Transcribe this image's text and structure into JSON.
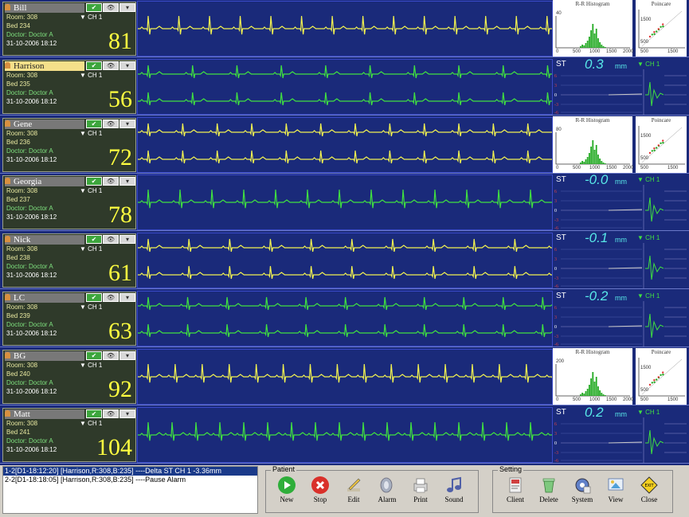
{
  "patients": [
    {
      "name": "Bill",
      "room": "Room: 308",
      "bed": "Bed 234",
      "doctor": "Doctor: Doctor A",
      "datetime": "31-10-2006 18:12",
      "hr": "81",
      "ch": "CH 1",
      "panel": "hist",
      "hist_title": "R-R Histogram",
      "hist_y": "40",
      "hist_x": [
        "0",
        "500",
        "1000",
        "1500",
        "2000"
      ],
      "poin_title": "Poincare",
      "poin_y": [
        "1500",
        "500"
      ],
      "poin_x": [
        "500",
        "1500"
      ],
      "wave_color": "#f2f250",
      "dual": false,
      "name_selected": false
    },
    {
      "name": "Harrison",
      "room": "Room: 308",
      "bed": "Bed 235",
      "doctor": "Doctor: Doctor A",
      "datetime": "31-10-2006 18:12",
      "hr": "56",
      "ch": "CH 1",
      "panel": "st",
      "st_label": "ST",
      "st_value": "0.3",
      "st_unit": "mm",
      "st_ch": "CH 1",
      "wave_color": "#40e040",
      "dual": true,
      "name_selected": true
    },
    {
      "name": "Gene",
      "room": "Room: 308",
      "bed": "Bed 236",
      "doctor": "Doctor: Doctor A",
      "datetime": "31-10-2006 18:12",
      "hr": "72",
      "ch": "CH 1",
      "panel": "hist",
      "hist_title": "R-R Histogram",
      "hist_y": "80",
      "hist_x": [
        "0",
        "500",
        "1000",
        "1500",
        "2000"
      ],
      "poin_title": "Poincare",
      "poin_y": [
        "1500",
        "500"
      ],
      "poin_x": [
        "500",
        "1500"
      ],
      "wave_color": "#f2f250",
      "dual": true,
      "name_selected": false
    },
    {
      "name": "Georgia",
      "room": "Room: 308",
      "bed": "Bed 237",
      "doctor": "Doctor: Doctor A",
      "datetime": "31-10-2006 18:12",
      "hr": "78",
      "ch": "CH 1",
      "panel": "st",
      "st_label": "ST",
      "st_value": "-0.0",
      "st_unit": "mm",
      "st_ch": "CH 1",
      "wave_color": "#40e040",
      "dual": false,
      "name_selected": false
    },
    {
      "name": "Nick",
      "room": "Room: 308",
      "bed": "Bed 238",
      "doctor": "Doctor: Doctor A",
      "datetime": "31-10-2006 18:12",
      "hr": "61",
      "ch": "CH 1",
      "panel": "st",
      "st_label": "ST",
      "st_value": "-0.1",
      "st_unit": "mm",
      "st_ch": "CH 1",
      "wave_color": "#f2f250",
      "dual": true,
      "name_selected": false
    },
    {
      "name": "LC",
      "room": "Room: 308",
      "bed": "Bed 239",
      "doctor": "Doctor: Doctor A",
      "datetime": "31-10-2006 18:12",
      "hr": "63",
      "ch": "CH 1",
      "panel": "st",
      "st_label": "ST",
      "st_value": "-0.2",
      "st_unit": "mm",
      "st_ch": "CH 1",
      "wave_color": "#40e040",
      "dual": true,
      "name_selected": false
    },
    {
      "name": "BG",
      "room": "Room: 308",
      "bed": "Bed 240",
      "doctor": "Doctor: Doctor A",
      "datetime": "31-10-2006 18:12",
      "hr": "92",
      "ch": "CH 1",
      "panel": "hist",
      "hist_title": "R-R Histogram",
      "hist_y": "200",
      "hist_x": [
        "0",
        "500",
        "1000",
        "1500",
        "2000"
      ],
      "poin_title": "Poincare",
      "poin_y": [
        "1500",
        "500"
      ],
      "poin_x": [
        "500",
        "1500"
      ],
      "wave_color": "#f2f250",
      "dual": false,
      "name_selected": false
    },
    {
      "name": "Matt",
      "room": "Room: 308",
      "bed": "Bed 241",
      "doctor": "Doctor: Doctor A",
      "datetime": "31-10-2006 18:12",
      "hr": "104",
      "ch": "CH 1",
      "panel": "st",
      "st_label": "ST",
      "st_value": "0.2",
      "st_unit": "mm",
      "st_ch": "CH 1",
      "wave_color": "#40e040",
      "dual": false,
      "name_selected": false
    }
  ],
  "alarms": [
    {
      "text": "1-2[D1-18:12:20] [Harrison,R:308,B:235] ----Delta ST CH 1    -3.36mm",
      "selected": true
    },
    {
      "text": "2-2[D1-18:18:05] [Harrison,R:308,B:235] ----Pause Alarm",
      "selected": false
    }
  ],
  "patient_group": {
    "label": "Patient",
    "tools": [
      {
        "label": "New",
        "icon": "play-icon"
      },
      {
        "label": "Stop",
        "icon": "stop-icon"
      },
      {
        "label": "Edit",
        "icon": "pencil-icon"
      },
      {
        "label": "Alarm",
        "icon": "alarm-icon"
      },
      {
        "label": "Print",
        "icon": "printer-icon"
      },
      {
        "label": "Sound",
        "icon": "music-note-icon"
      }
    ]
  },
  "setting_group": {
    "label": "Setting",
    "tools": [
      {
        "label": "Client",
        "icon": "client-icon"
      },
      {
        "label": "Delete",
        "icon": "trash-icon"
      },
      {
        "label": "System",
        "icon": "gear-icon"
      },
      {
        "label": "View",
        "icon": "view-icon"
      },
      {
        "label": "Close",
        "icon": "exit-icon"
      }
    ]
  },
  "colors": {
    "bg": "#1a2a7a",
    "yellow_wave": "#f2f250",
    "green_wave": "#40e040",
    "st_value": "#58e8e8"
  }
}
